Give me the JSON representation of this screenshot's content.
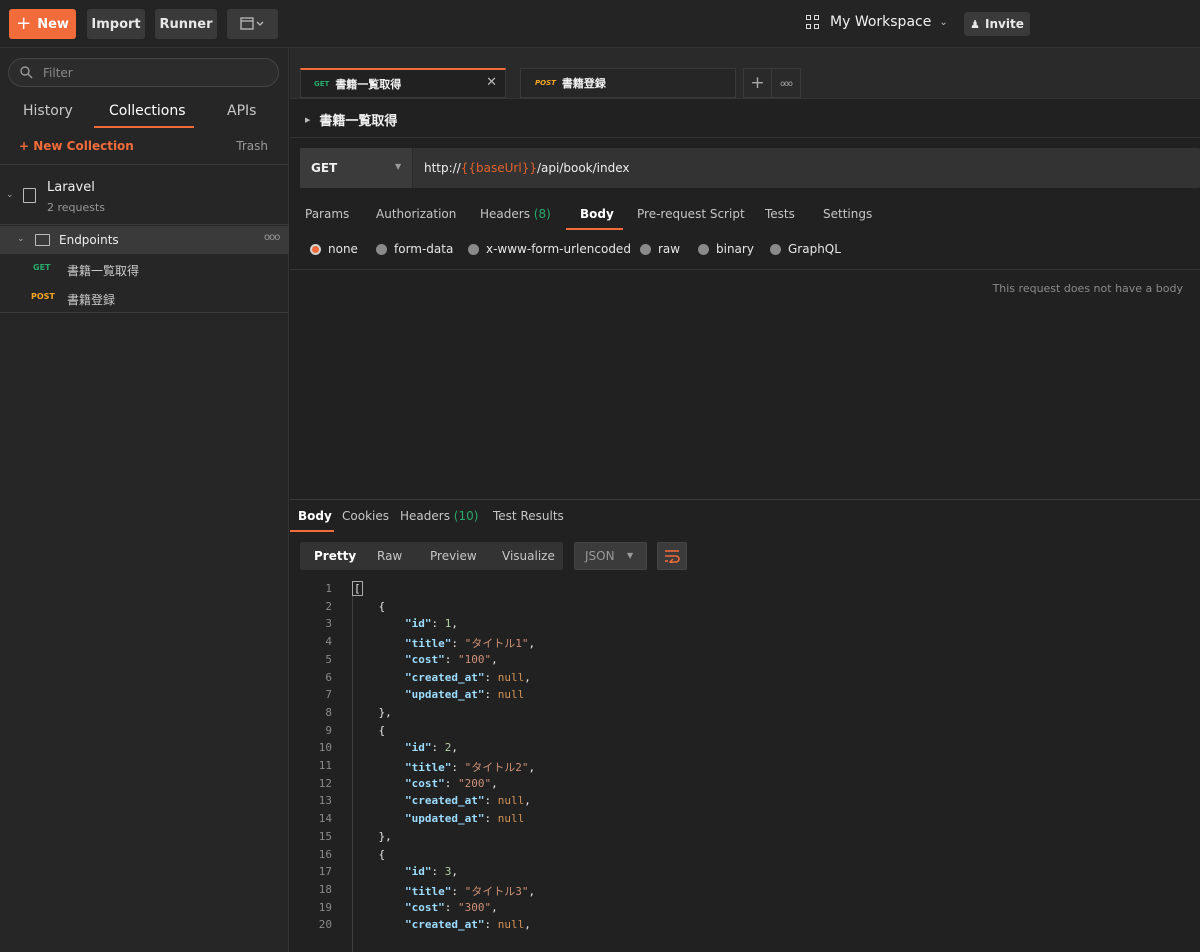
{
  "topbar": {
    "new_label": "New",
    "import_label": "Import",
    "runner_label": "Runner",
    "workspace_label": "My Workspace",
    "invite_label": "Invite"
  },
  "sidebar": {
    "filter_placeholder": "Filter",
    "tabs": [
      "History",
      "Collections",
      "APIs"
    ],
    "new_collection_label": "+ New Collection",
    "trash_label": "Trash",
    "collection": {
      "name": "Laravel",
      "count": "2 requests",
      "folder": "Endpoints",
      "requests": [
        {
          "method": "GET",
          "name": "書籍一覧取得"
        },
        {
          "method": "POST",
          "name": "書籍登録"
        }
      ]
    }
  },
  "request_tabs": [
    {
      "method": "GET",
      "name": "書籍一覧取得"
    },
    {
      "method": "POST",
      "name": "書籍登録"
    }
  ],
  "request": {
    "name": "書籍一覧取得",
    "method": "GET",
    "url_prefix": "http://",
    "url_var": "{{baseUrl}}",
    "url_suffix": "/api/book/index",
    "tabs": {
      "params": "Params",
      "authorization": "Authorization",
      "headers": "Headers",
      "headers_count": "(8)",
      "body": "Body",
      "prerequest": "Pre-request Script",
      "tests": "Tests",
      "settings": "Settings"
    },
    "body_modes": [
      "none",
      "form-data",
      "x-www-form-urlencoded",
      "raw",
      "binary",
      "GraphQL"
    ],
    "selected_body_mode": "none",
    "no_body_text": "This request does not have a body"
  },
  "response": {
    "tabs": {
      "body": "Body",
      "cookies": "Cookies",
      "headers": "Headers",
      "headers_count": "(10)",
      "test_results": "Test Results"
    },
    "views": [
      "Pretty",
      "Raw",
      "Preview",
      "Visualize"
    ],
    "format": "JSON",
    "lines": [
      {
        "n": "1",
        "text": "["
      },
      {
        "n": "2",
        "text": "    {"
      },
      {
        "n": "3",
        "key": "\"id\"",
        "val": "1",
        "type": "num",
        "comma": ","
      },
      {
        "n": "4",
        "key": "\"title\"",
        "val": "\"タイトル1\"",
        "type": "str",
        "comma": ","
      },
      {
        "n": "5",
        "key": "\"cost\"",
        "val": "\"100\"",
        "type": "str",
        "comma": ","
      },
      {
        "n": "6",
        "key": "\"created_at\"",
        "val": "null",
        "type": "null",
        "comma": ","
      },
      {
        "n": "7",
        "key": "\"updated_at\"",
        "val": "null",
        "type": "null",
        "comma": ""
      },
      {
        "n": "8",
        "text": "    },"
      },
      {
        "n": "9",
        "text": "    {"
      },
      {
        "n": "10",
        "key": "\"id\"",
        "val": "2",
        "type": "num",
        "comma": ","
      },
      {
        "n": "11",
        "key": "\"title\"",
        "val": "\"タイトル2\"",
        "type": "str",
        "comma": ","
      },
      {
        "n": "12",
        "key": "\"cost\"",
        "val": "\"200\"",
        "type": "str",
        "comma": ","
      },
      {
        "n": "13",
        "key": "\"created_at\"",
        "val": "null",
        "type": "null",
        "comma": ","
      },
      {
        "n": "14",
        "key": "\"updated_at\"",
        "val": "null",
        "type": "null",
        "comma": ""
      },
      {
        "n": "15",
        "text": "    },"
      },
      {
        "n": "16",
        "text": "    {"
      },
      {
        "n": "17",
        "key": "\"id\"",
        "val": "3",
        "type": "num",
        "comma": ","
      },
      {
        "n": "18",
        "key": "\"title\"",
        "val": "\"タイトル3\"",
        "type": "str",
        "comma": ","
      },
      {
        "n": "19",
        "key": "\"cost\"",
        "val": "\"300\"",
        "type": "str",
        "comma": ","
      },
      {
        "n": "20",
        "key": "\"created_at\"",
        "val": "null",
        "type": "null",
        "comma": ","
      }
    ]
  },
  "colors": {
    "accent": "#f26b3a",
    "get": "#27a96a",
    "post": "#f5a623"
  }
}
